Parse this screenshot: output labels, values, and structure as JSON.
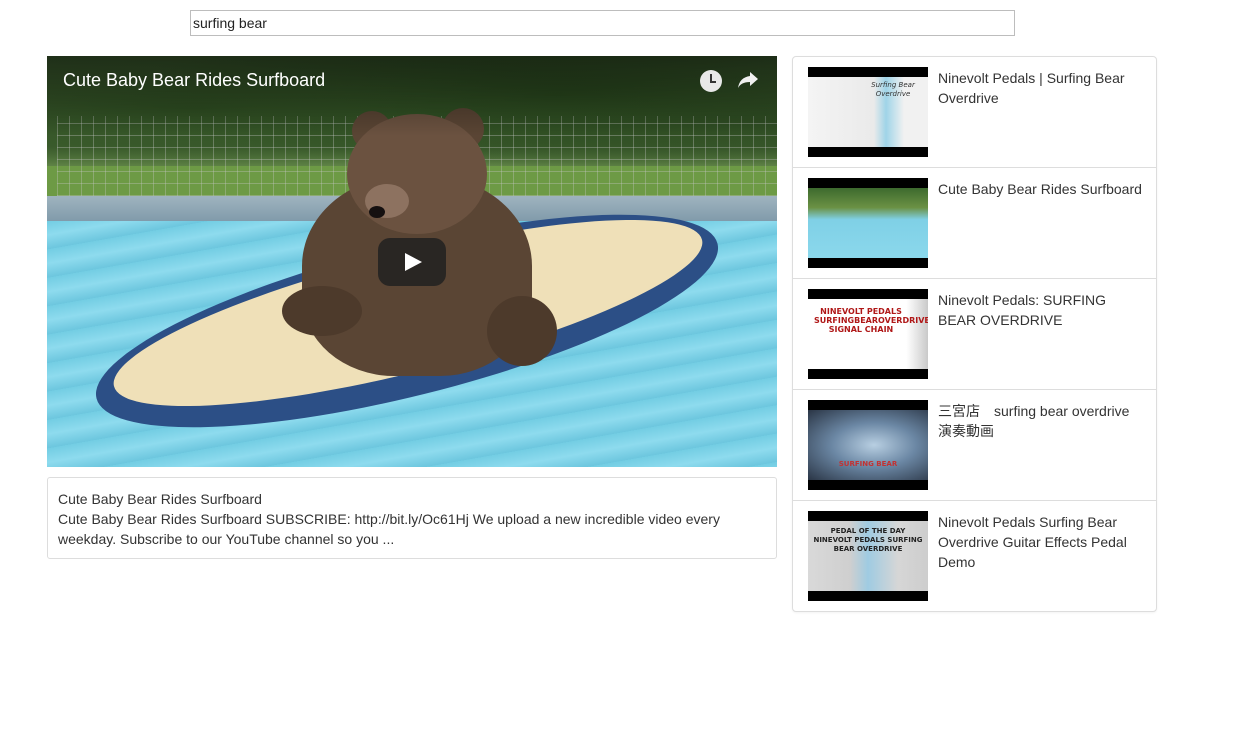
{
  "search": {
    "value": "surfing bear"
  },
  "player": {
    "title": "Cute Baby Bear Rides Surfboard",
    "icons": [
      "clock-icon",
      "share-icon",
      "play-icon"
    ]
  },
  "description": {
    "title": "Cute Baby Bear Rides Surfboard",
    "text": "Cute Baby Bear Rides Surfboard SUBSCRIBE: http://bit.ly/Oc61Hj We upload a new incredible video every weekday. Subscribe to our YouTube channel so you ..."
  },
  "video_list": [
    {
      "title": "Ninevolt Pedals | Surfing Bear Overdrive",
      "thumb_text": "Surfing Bear Overdrive"
    },
    {
      "title": "Cute Baby Bear Rides Surfboard"
    },
    {
      "title": "Ninevolt Pedals: SURFING BEAR OVERDRIVE",
      "thumb_text": "NINEVOLT PEDALS SURFINGBEAROVERDRIVE SIGNAL CHAIN"
    },
    {
      "title": "三宮店　surfing bear overdrive 演奏動画",
      "thumb_text": "SURFING BEAR"
    },
    {
      "title": "Ninevolt Pedals Surfing Bear Overdrive Guitar Effects Pedal Demo",
      "thumb_text": "PEDAL OF THE DAY NINEVOLT PEDALS SURFING BEAR OVERDRIVE"
    }
  ],
  "colors": {
    "border": "#dddddd",
    "text": "#333333",
    "play_button": "#212121"
  }
}
